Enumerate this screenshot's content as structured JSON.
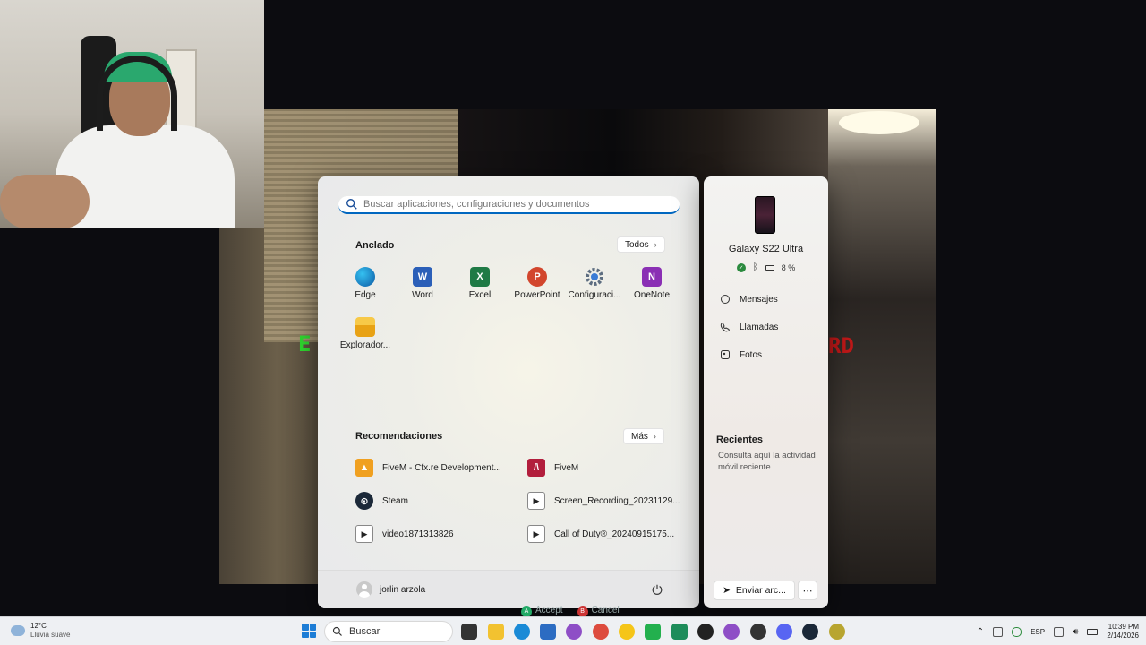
{
  "start_menu": {
    "search_placeholder": "Buscar aplicaciones, configuraciones y documentos",
    "pinned_title": "Anclado",
    "pinned_all_label": "Todos",
    "pinned_apps": [
      {
        "label": "Edge",
        "color": "#0c7fd6"
      },
      {
        "label": "Word",
        "color": "#2b5fb8"
      },
      {
        "label": "Excel",
        "color": "#1f7a45"
      },
      {
        "label": "PowerPoint",
        "color": "#d2462d"
      },
      {
        "label": "Configuraci...",
        "color": "#5d6d80"
      },
      {
        "label": "OneNote",
        "color": "#8a2fb4"
      },
      {
        "label": "Explorador...",
        "color": "#e8b320"
      }
    ],
    "recommendations_title": "Recomendaciones",
    "recommendations_more_label": "Más",
    "recommendations": [
      {
        "label": "FiveM - Cfx.re Development...",
        "color": "#f0a020"
      },
      {
        "label": "FiveM",
        "color": "#b21e3c"
      },
      {
        "label": "Steam",
        "color": "#1b2838"
      },
      {
        "label": "Screen_Recording_20231129...",
        "color": "#444444"
      },
      {
        "label": "video1871313826",
        "color": "#444444"
      },
      {
        "label": "Call of Duty®_20240915175...",
        "color": "#444444"
      }
    ],
    "user_name": "jorlin arzola"
  },
  "phone_panel": {
    "device_name": "Galaxy S22 Ultra",
    "battery": "8 %",
    "links": [
      "Mensajes",
      "Llamadas",
      "Fotos"
    ],
    "recent_title": "Recientes",
    "recent_desc": "Consulta aquí la actividad móvil reciente.",
    "send_label": "Enviar arc..."
  },
  "overlay": {
    "accept_key": "A",
    "accept_label": "Accept",
    "cancel_key": "B",
    "cancel_label": "Cancel"
  },
  "game": {
    "left_text": "E",
    "right_text": "RD"
  },
  "taskbar": {
    "weather_temp": "12°C",
    "weather_desc": "Lluvia suave",
    "search_label": "Buscar",
    "language": "ESP",
    "time": "10:39 PM",
    "date": "2/14/2026"
  }
}
